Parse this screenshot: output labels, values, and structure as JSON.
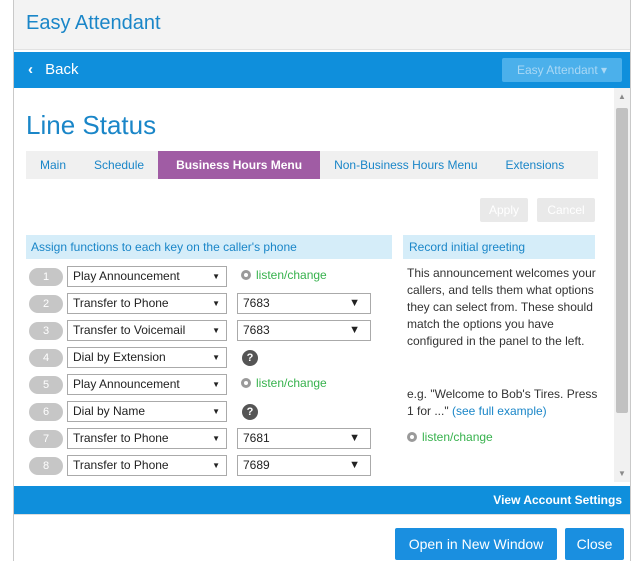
{
  "window": {
    "title": "Easy Attendant"
  },
  "nav": {
    "back_label": "Back",
    "app_menu_label": "Easy Attendant ▾"
  },
  "page": {
    "title": "Line Status"
  },
  "tabs": [
    {
      "label": "Main",
      "active": false
    },
    {
      "label": "Schedule",
      "active": false
    },
    {
      "label": "Business Hours Menu",
      "active": true
    },
    {
      "label": "Non-Business Hours Menu",
      "active": false
    },
    {
      "label": "Extensions",
      "active": false
    }
  ],
  "actions": {
    "apply_label": "Apply",
    "cancel_label": "Cancel"
  },
  "assign": {
    "header": "Assign functions to each key on the caller's phone",
    "rows": [
      {
        "key": "1",
        "function": "Play Announcement",
        "extra": "listen/change"
      },
      {
        "key": "2",
        "function": "Transfer to Phone",
        "extension": "7683"
      },
      {
        "key": "3",
        "function": "Transfer to Voicemail",
        "extension": "7683"
      },
      {
        "key": "4",
        "function": "Dial by Extension",
        "help": "?"
      },
      {
        "key": "5",
        "function": "Play Announcement",
        "extra": "listen/change"
      },
      {
        "key": "6",
        "function": "Dial by Name",
        "help": "?"
      },
      {
        "key": "7",
        "function": "Transfer to Phone",
        "extension": "7681"
      },
      {
        "key": "8",
        "function": "Transfer to Phone",
        "extension": "7689"
      }
    ]
  },
  "greeting": {
    "header": "Record initial greeting",
    "description": "This announcement welcomes your callers, and tells them what options they can select from. These should match the options you have configured in the panel to the left.",
    "example_prefix": "e.g. \"Welcome to Bob's Tires. Press 1 for ...\"",
    "example_link": "(see full example)",
    "listen_label": "listen/change"
  },
  "footer": {
    "account_link": "View Account Settings",
    "open_window_label": "Open in New Window",
    "close_label": "Close"
  },
  "colors": {
    "accent": "#1a86c8",
    "nav": "#0f8fdc",
    "active_tab": "#a05ca4",
    "listen": "#37b24d"
  }
}
